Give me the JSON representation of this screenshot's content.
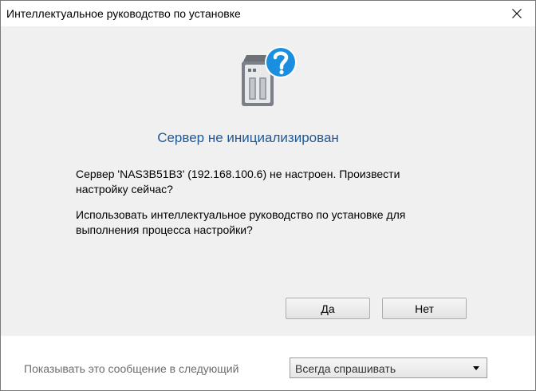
{
  "window": {
    "title": "Интеллектуальное руководство по установке"
  },
  "dialog": {
    "heading": "Сервер не инициализирован",
    "message1": "Сервер 'NAS3B51B3' (192.168.100.6) не настроен. Произвести настройку сейчас?",
    "message2": "Использовать интеллектуальное руководство по установке для выполнения процесса настройки?",
    "yes_label": "Да",
    "no_label": "Нет"
  },
  "footer": {
    "label": "Показывать это сообщение в следующий",
    "select_value": "Всегда спрашивать"
  },
  "icons": {
    "main": "nas-question-icon",
    "close": "close-icon",
    "dropdown": "chevron-down-icon"
  },
  "colors": {
    "heading": "#1e5a99",
    "question_badge": "#1a8fe0",
    "content_bg": "#f0f0f0"
  }
}
